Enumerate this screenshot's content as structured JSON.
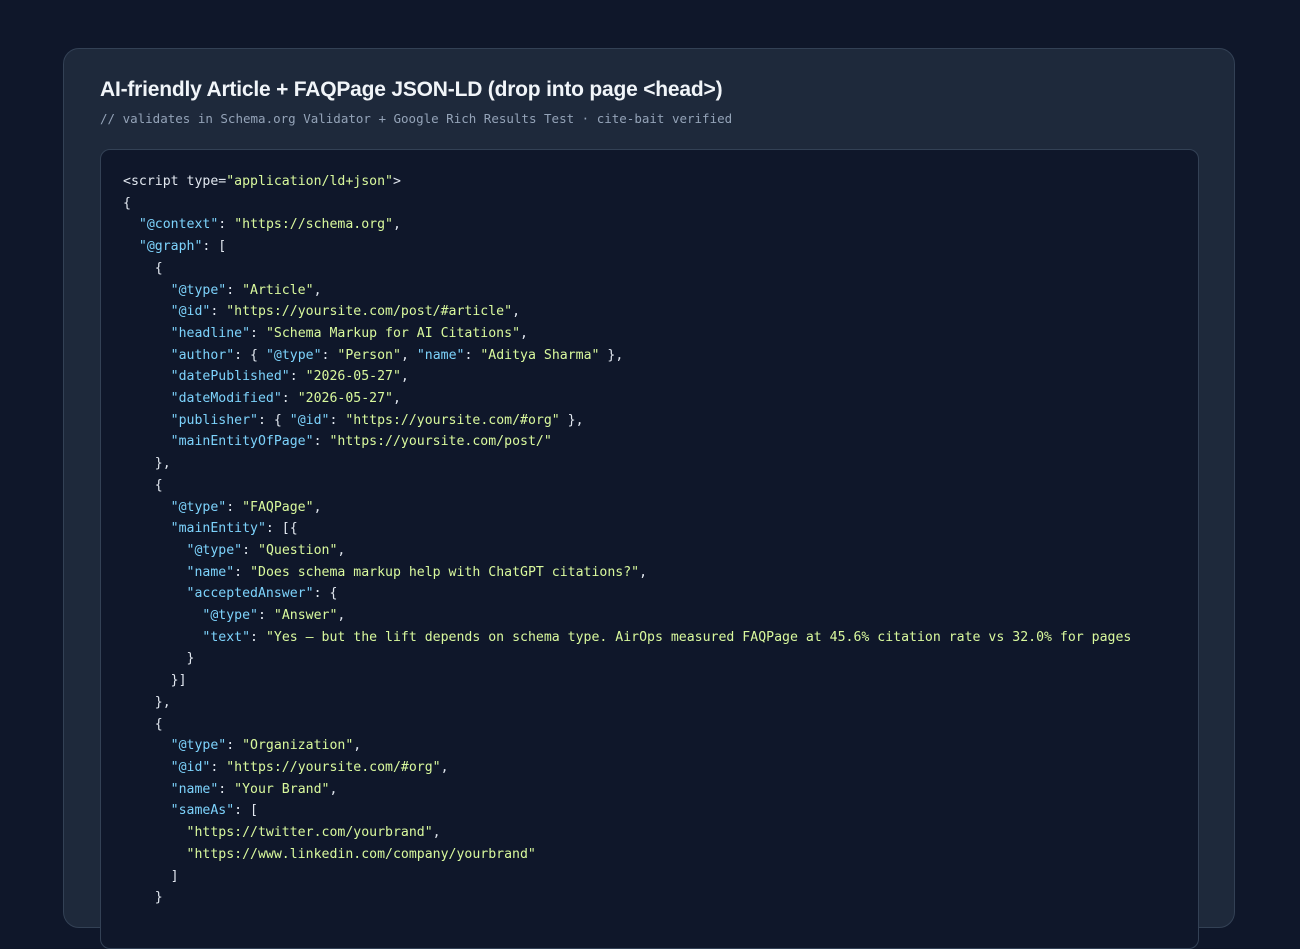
{
  "card": {
    "title": "AI-friendly Article + FAQPage JSON-LD (drop into page <head>)",
    "subtitle": "// validates in Schema.org Validator + Google Rich Results Test · cite-bait verified"
  },
  "code": {
    "lines": [
      [
        {
          "t": "tag",
          "v": "<script "
        },
        {
          "t": "attr",
          "v": "type="
        },
        {
          "t": "str",
          "v": "\"application/ld+json\""
        },
        {
          "t": "tag",
          "v": ">"
        }
      ],
      [
        {
          "t": "p",
          "v": "{"
        }
      ],
      [
        {
          "t": "p",
          "v": "  "
        },
        {
          "t": "key",
          "v": "\"@context\""
        },
        {
          "t": "p",
          "v": ": "
        },
        {
          "t": "str",
          "v": "\"https://schema.org\""
        },
        {
          "t": "p",
          "v": ","
        }
      ],
      [
        {
          "t": "p",
          "v": "  "
        },
        {
          "t": "key",
          "v": "\"@graph\""
        },
        {
          "t": "p",
          "v": ": ["
        }
      ],
      [
        {
          "t": "p",
          "v": "    {"
        }
      ],
      [
        {
          "t": "p",
          "v": "      "
        },
        {
          "t": "key",
          "v": "\"@type\""
        },
        {
          "t": "p",
          "v": ": "
        },
        {
          "t": "str",
          "v": "\"Article\""
        },
        {
          "t": "p",
          "v": ","
        }
      ],
      [
        {
          "t": "p",
          "v": "      "
        },
        {
          "t": "key",
          "v": "\"@id\""
        },
        {
          "t": "p",
          "v": ": "
        },
        {
          "t": "str",
          "v": "\"https://yoursite.com/post/#article\""
        },
        {
          "t": "p",
          "v": ","
        }
      ],
      [
        {
          "t": "p",
          "v": "      "
        },
        {
          "t": "key",
          "v": "\"headline\""
        },
        {
          "t": "p",
          "v": ": "
        },
        {
          "t": "str",
          "v": "\"Schema Markup for AI Citations\""
        },
        {
          "t": "p",
          "v": ","
        }
      ],
      [
        {
          "t": "p",
          "v": "      "
        },
        {
          "t": "key",
          "v": "\"author\""
        },
        {
          "t": "p",
          "v": ": { "
        },
        {
          "t": "key",
          "v": "\"@type\""
        },
        {
          "t": "p",
          "v": ": "
        },
        {
          "t": "str",
          "v": "\"Person\""
        },
        {
          "t": "p",
          "v": ", "
        },
        {
          "t": "key",
          "v": "\"name\""
        },
        {
          "t": "p",
          "v": ": "
        },
        {
          "t": "str",
          "v": "\"Aditya Sharma\""
        },
        {
          "t": "p",
          "v": " },"
        }
      ],
      [
        {
          "t": "p",
          "v": "      "
        },
        {
          "t": "key",
          "v": "\"datePublished\""
        },
        {
          "t": "p",
          "v": ": "
        },
        {
          "t": "str",
          "v": "\"2026-05-27\""
        },
        {
          "t": "p",
          "v": ","
        }
      ],
      [
        {
          "t": "p",
          "v": "      "
        },
        {
          "t": "key",
          "v": "\"dateModified\""
        },
        {
          "t": "p",
          "v": ": "
        },
        {
          "t": "str",
          "v": "\"2026-05-27\""
        },
        {
          "t": "p",
          "v": ","
        }
      ],
      [
        {
          "t": "p",
          "v": "      "
        },
        {
          "t": "key",
          "v": "\"publisher\""
        },
        {
          "t": "p",
          "v": ": { "
        },
        {
          "t": "key",
          "v": "\"@id\""
        },
        {
          "t": "p",
          "v": ": "
        },
        {
          "t": "str",
          "v": "\"https://yoursite.com/#org\""
        },
        {
          "t": "p",
          "v": " },"
        }
      ],
      [
        {
          "t": "p",
          "v": "      "
        },
        {
          "t": "key",
          "v": "\"mainEntityOfPage\""
        },
        {
          "t": "p",
          "v": ": "
        },
        {
          "t": "str",
          "v": "\"https://yoursite.com/post/\""
        }
      ],
      [
        {
          "t": "p",
          "v": "    },"
        }
      ],
      [
        {
          "t": "p",
          "v": "    {"
        }
      ],
      [
        {
          "t": "p",
          "v": "      "
        },
        {
          "t": "key",
          "v": "\"@type\""
        },
        {
          "t": "p",
          "v": ": "
        },
        {
          "t": "str",
          "v": "\"FAQPage\""
        },
        {
          "t": "p",
          "v": ","
        }
      ],
      [
        {
          "t": "p",
          "v": "      "
        },
        {
          "t": "key",
          "v": "\"mainEntity\""
        },
        {
          "t": "p",
          "v": ": [{"
        }
      ],
      [
        {
          "t": "p",
          "v": "        "
        },
        {
          "t": "key",
          "v": "\"@type\""
        },
        {
          "t": "p",
          "v": ": "
        },
        {
          "t": "str",
          "v": "\"Question\""
        },
        {
          "t": "p",
          "v": ","
        }
      ],
      [
        {
          "t": "p",
          "v": "        "
        },
        {
          "t": "key",
          "v": "\"name\""
        },
        {
          "t": "p",
          "v": ": "
        },
        {
          "t": "str",
          "v": "\"Does schema markup help with ChatGPT citations?\""
        },
        {
          "t": "p",
          "v": ","
        }
      ],
      [
        {
          "t": "p",
          "v": "        "
        },
        {
          "t": "key",
          "v": "\"acceptedAnswer\""
        },
        {
          "t": "p",
          "v": ": {"
        }
      ],
      [
        {
          "t": "p",
          "v": "          "
        },
        {
          "t": "key",
          "v": "\"@type\""
        },
        {
          "t": "p",
          "v": ": "
        },
        {
          "t": "str",
          "v": "\"Answer\""
        },
        {
          "t": "p",
          "v": ","
        }
      ],
      [
        {
          "t": "p",
          "v": "          "
        },
        {
          "t": "key",
          "v": "\"text\""
        },
        {
          "t": "p",
          "v": ": "
        },
        {
          "t": "str",
          "v": "\"Yes — but the lift depends on schema type. AirOps measured FAQPage at 45.6% citation rate vs 32.0% for pages"
        }
      ],
      [
        {
          "t": "p",
          "v": "        }"
        }
      ],
      [
        {
          "t": "p",
          "v": "      }]"
        }
      ],
      [
        {
          "t": "p",
          "v": "    },"
        }
      ],
      [
        {
          "t": "p",
          "v": "    {"
        }
      ],
      [
        {
          "t": "p",
          "v": "      "
        },
        {
          "t": "key",
          "v": "\"@type\""
        },
        {
          "t": "p",
          "v": ": "
        },
        {
          "t": "str",
          "v": "\"Organization\""
        },
        {
          "t": "p",
          "v": ","
        }
      ],
      [
        {
          "t": "p",
          "v": "      "
        },
        {
          "t": "key",
          "v": "\"@id\""
        },
        {
          "t": "p",
          "v": ": "
        },
        {
          "t": "str",
          "v": "\"https://yoursite.com/#org\""
        },
        {
          "t": "p",
          "v": ","
        }
      ],
      [
        {
          "t": "p",
          "v": "      "
        },
        {
          "t": "key",
          "v": "\"name\""
        },
        {
          "t": "p",
          "v": ": "
        },
        {
          "t": "str",
          "v": "\"Your Brand\""
        },
        {
          "t": "p",
          "v": ","
        }
      ],
      [
        {
          "t": "p",
          "v": "      "
        },
        {
          "t": "key",
          "v": "\"sameAs\""
        },
        {
          "t": "p",
          "v": ": ["
        }
      ],
      [
        {
          "t": "p",
          "v": "        "
        },
        {
          "t": "str",
          "v": "\"https://twitter.com/yourbrand\""
        },
        {
          "t": "p",
          "v": ","
        }
      ],
      [
        {
          "t": "p",
          "v": "        "
        },
        {
          "t": "str",
          "v": "\"https://www.linkedin.com/company/yourbrand\""
        }
      ],
      [
        {
          "t": "p",
          "v": "      ]"
        }
      ],
      [
        {
          "t": "p",
          "v": "    }"
        }
      ]
    ]
  }
}
